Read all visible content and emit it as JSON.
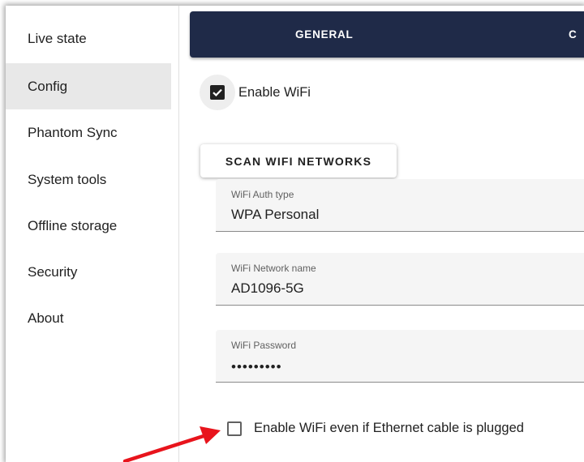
{
  "sidebar": {
    "items": [
      {
        "label": "Live state"
      },
      {
        "label": "Config",
        "active": true
      },
      {
        "label": "Phantom Sync"
      },
      {
        "label": "System tools"
      },
      {
        "label": "Offline storage"
      },
      {
        "label": "Security"
      },
      {
        "label": "About"
      }
    ]
  },
  "tabs": [
    {
      "label": "GENERAL"
    },
    {
      "label": "C"
    }
  ],
  "wifi": {
    "enable_label": "Enable WiFi",
    "enable_checked": true,
    "scan_label": "SCAN WIFI NETWORKS",
    "auth": {
      "label": "WiFi Auth type",
      "value": "WPA Personal"
    },
    "network": {
      "label": "WiFi Network name",
      "value": "AD1096-5G"
    },
    "password": {
      "label": "WiFi Password",
      "value": "•••••••••"
    },
    "ethernet_label": "Enable WiFi even if Ethernet cable is plugged",
    "ethernet_checked": false
  },
  "colors": {
    "tabbar": "#1f2a48",
    "active_item": "#e8e8e8",
    "annotation_arrow": "#e8141c"
  },
  "icons": {
    "checkbox_checked": "check-icon",
    "annotation": "red-arrow-icon"
  }
}
